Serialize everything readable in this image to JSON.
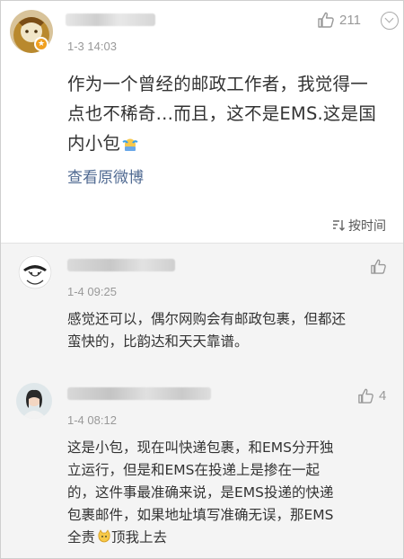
{
  "post": {
    "time": "1-3 14:03",
    "like_count": "211",
    "text_lines": [
      "作为一个曾经的邮政工作者，我觉得一",
      "点也不稀奇…而且，这不是EMS.这是国",
      "内小包"
    ],
    "view_original": "查看原微博",
    "sort_label": "按时间",
    "sort_icon": "sort-icon"
  },
  "comments": [
    {
      "time": "1-4 09:25",
      "text_lines": [
        "感觉还可以，偶尔网购会有邮政包裹，但都还",
        "蛮快的，比韵达和天天靠谱。"
      ],
      "like_count": ""
    },
    {
      "time": "1-4 08:12",
      "like_count": "4",
      "text_lines": [
        "这是小包，现在叫快递包裹，和EMS分开独",
        "立运行，但是和EMS在投递上是掺在一起",
        "的，这件事最准确来说，是EMS投递的快递",
        "包裹邮件，如果地址填写准确无误，那EMS",
        "全责",
        "顶我上去"
      ]
    }
  ],
  "colors": {
    "link": "#506a92",
    "muted": "#999999",
    "comment_bg": "#f4f4f4",
    "badge": "#f0a020"
  }
}
